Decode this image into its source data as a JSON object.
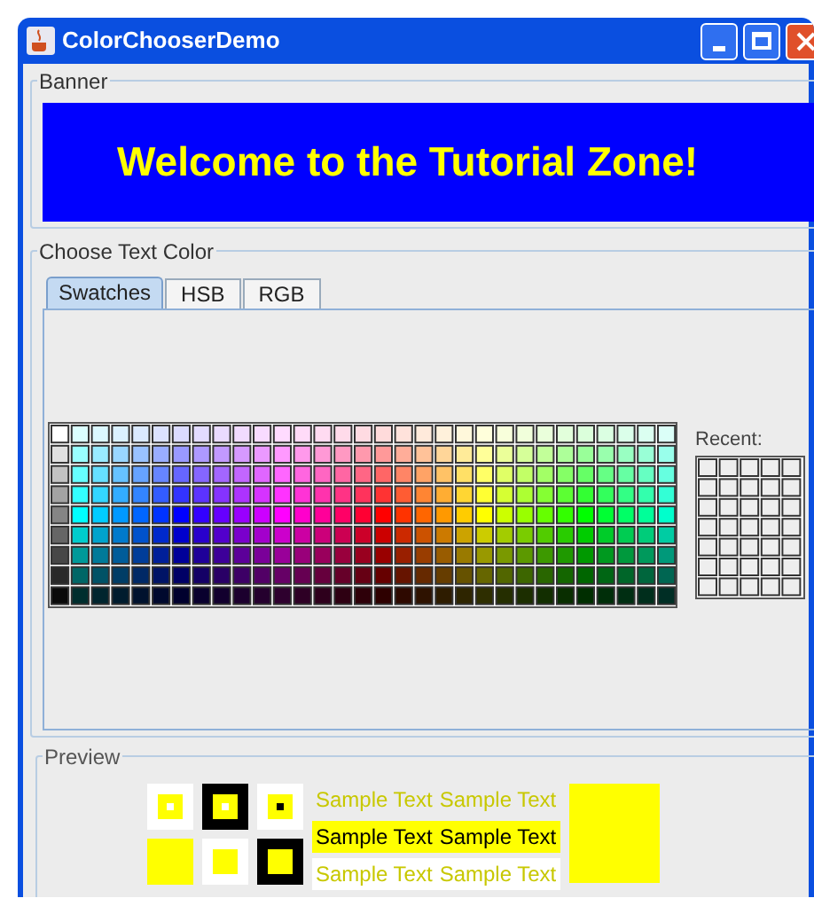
{
  "window": {
    "title": "ColorChooserDemo"
  },
  "banner": {
    "title": "Banner",
    "text": "Welcome to the Tutorial Zone!"
  },
  "chooser": {
    "title": "Choose Text Color",
    "tabs": [
      {
        "label": "Swatches",
        "selected": true
      },
      {
        "label": "HSB",
        "selected": false
      },
      {
        "label": "RGB",
        "selected": false
      }
    ],
    "recent_label": "Recent:"
  },
  "preview": {
    "title": "Preview",
    "samples": [
      {
        "kind": "plain",
        "texts": [
          "Sample Text",
          "Sample Text"
        ]
      },
      {
        "kind": "inverse",
        "texts": [
          "Sample Text",
          "Sample Text"
        ]
      },
      {
        "kind": "white",
        "texts": [
          "Sample Text",
          "Sample Text"
        ]
      }
    ]
  }
}
